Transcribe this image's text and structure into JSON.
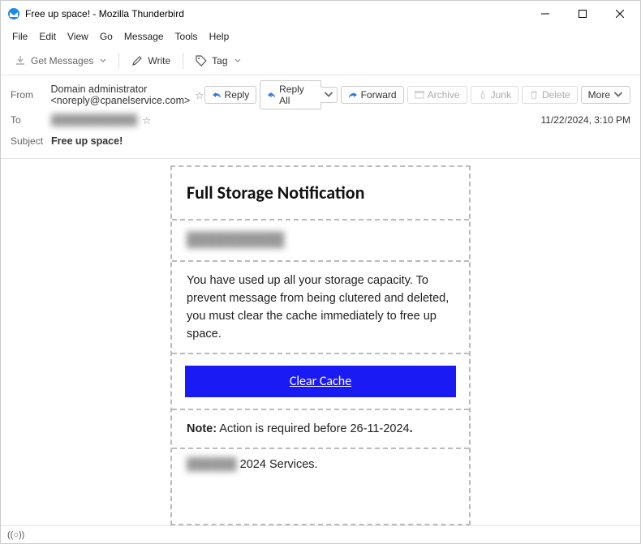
{
  "window": {
    "title": "Free up space! - Mozilla Thunderbird"
  },
  "menubar": [
    "File",
    "Edit",
    "View",
    "Go",
    "Message",
    "Tools",
    "Help"
  ],
  "toolbar": {
    "get_messages": "Get Messages",
    "write": "Write",
    "tag": "Tag"
  },
  "header": {
    "from_label": "From",
    "from_value": "Domain administrator <noreply@cpanelservice.com>",
    "to_label": "To",
    "to_redacted": "████████████",
    "subject_label": "Subject",
    "subject_value": "Free up space!",
    "date": "11/22/2024, 3:10 PM"
  },
  "actions": {
    "reply": "Reply",
    "reply_all": "Reply All",
    "forward": "Forward",
    "archive": "Archive",
    "junk": "Junk",
    "delete": "Delete",
    "more": "More"
  },
  "email": {
    "title": "Full Storage Notification",
    "recipient_redacted": "██████████",
    "body": "You have used up all your storage capacity. To prevent message from being clutered and deleted, you must clear the cache immediately to free up space.",
    "cta": "Clear Cache",
    "note_label": "Note:",
    "note_text": " Action is required before 26-11-2024",
    "note_period": ".",
    "footer_redacted": "██████",
    "footer_suffix": " 2024 Services."
  },
  "statusbar": {
    "signal": "((○))"
  }
}
